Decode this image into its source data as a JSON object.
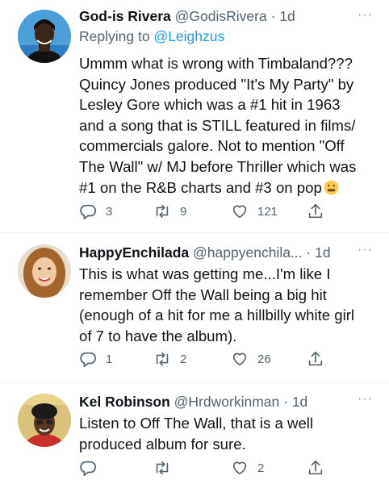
{
  "tweets": [
    {
      "name": "God-is Rivera",
      "handle": "@GodisRivera",
      "separator": "·",
      "time": "1d",
      "replying_prefix": "Replying to",
      "replying_to": "@Leighzus",
      "text": "Ummm what is wrong with Timbaland???\nQuincy Jones produced \"It's My Party\" by\nLesley Gore which was a #1 hit in 1963\nand a song that is STILL featured in films/\ncommercials galore. Not to mention \"Off\nThe Wall\" w/ MJ before Thriller which was\n#1 on the R&B charts and #3 on pop",
      "emoji": "grimacing-face-icon",
      "replies": "3",
      "retweets": "9",
      "likes": "121"
    },
    {
      "name": "HappyEnchilada",
      "handle": "@happyenchila...",
      "separator": "·",
      "time": "1d",
      "text": "This is what was getting me...I'm like I\nremember Off the Wall being a big hit\n(enough of a hit for me a hillbilly white girl\nof 7 to have the album).",
      "replies": "1",
      "retweets": "2",
      "likes": "26"
    },
    {
      "name": "Kel Robinson",
      "handle": "@Hrdworkinman",
      "separator": "·",
      "time": "1d",
      "text": "Listen to Off The Wall, that is a well\nproduced album for sure.",
      "replies": "",
      "retweets": "",
      "likes": "2"
    }
  ],
  "more_label": "···",
  "colors": {
    "text": "#0f1419",
    "secondary": "#536471",
    "link": "#1d9bf0",
    "divider": "#eff3f4"
  }
}
